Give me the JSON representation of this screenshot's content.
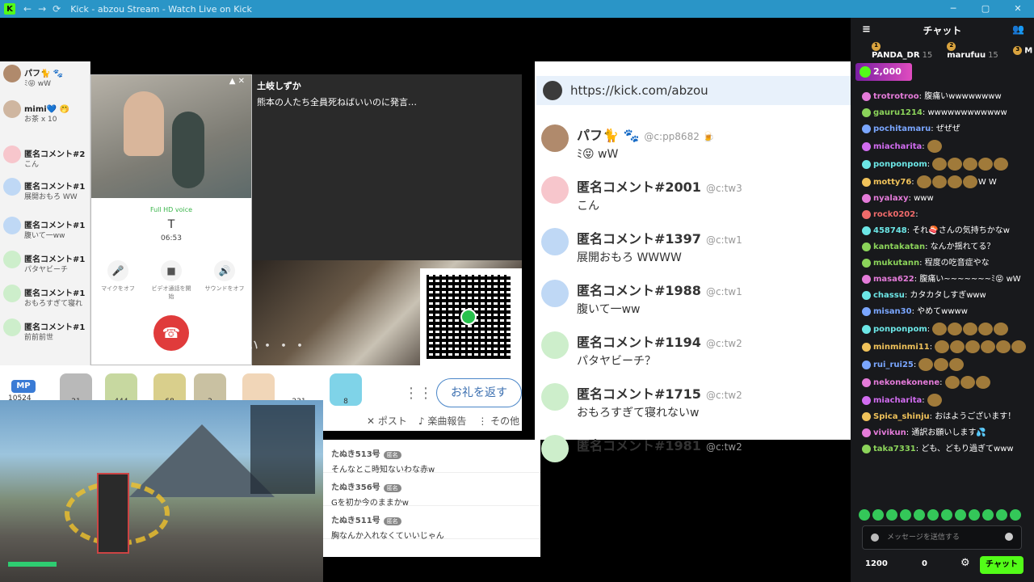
{
  "window": {
    "title": "Kick - abzou Stream - Watch Live on Kick",
    "logo": "K",
    "back": "←",
    "forward": "→",
    "reload": "⟳",
    "minimize": "─",
    "maximize": "▢",
    "close": "✕"
  },
  "left_chat": [
    {
      "name": "パフ🐈 🐾",
      "text": "ﾐ😝 wW",
      "avatar_color": "#b08a6c"
    },
    {
      "name": "mimi💙 🤭",
      "text": "お茶 x 10",
      "avatar_color": "#cfb6a0"
    },
    {
      "name": "匿名コメント#2",
      "text": "こん",
      "avatar_color": "#f7c6cc"
    },
    {
      "name": "匿名コメント#1",
      "text": "展開おもろ WW",
      "avatar_color": "#bfd8f5"
    },
    {
      "name": "匿名コメント#1",
      "text": "腹いて一ww",
      "avatar_color": "#bfd8f5"
    },
    {
      "name": "匿名コメント#1",
      "text": "パタヤビーチ",
      "avatar_color": "#cdeecb"
    },
    {
      "name": "匿名コメント#1",
      "text": "おもろすぎて寝れ",
      "avatar_color": "#cdeecb"
    },
    {
      "name": "匿名コメント#1",
      "text": "前前前世",
      "avatar_color": "#cdeecb"
    }
  ],
  "phone": {
    "quality": "Full HD voice",
    "contact": "T",
    "duration": "06:53",
    "mute_label": "マイクをオフ",
    "video_label": "ビデオ通話を開始",
    "sound_label": "サウンドをオフ",
    "mic_icon": "🎤",
    "video_icon": "■",
    "sound_icon": "🔊",
    "hangup_icon": "☎",
    "window_controls": "▲ ✕"
  },
  "dark_panel": {
    "name": "土岐しずか",
    "message": "熊本の人たち全員死ねばいいのに発言…"
  },
  "overlay_text": "やばい・・・",
  "giftbar": {
    "mp_label": "MP",
    "mp_value": "10524",
    "thanks_button": "お礼を返す",
    "gifts": [
      {
        "label": "21",
        "color": "#b9b9b9"
      },
      {
        "label": "444",
        "color": "#c7d8a0"
      },
      {
        "label": "68",
        "color": "#d9cf8c"
      },
      {
        "label": "2",
        "color": "#c9c1a2"
      },
      {
        "label": "",
        "color": "#f1d6b8"
      },
      {
        "label": "231",
        "color": "#ffffff"
      },
      {
        "label": "8",
        "color": "#7fd3e8"
      }
    ]
  },
  "sharebar": {
    "post": "✕ ポスト",
    "song": "♪ 楽曲報告",
    "more": "⋮ その他"
  },
  "right_panel": {
    "url": "https://kick.com/abzou",
    "comments": [
      {
        "name": "パフ🐈 🐾",
        "tag": "@c:pp8682 🍺",
        "text": "ﾐ😝 wW",
        "avatar_color": "#b08a6c"
      },
      {
        "name": "匿名コメント#2001",
        "tag": "@c:tw3",
        "text": "こん",
        "avatar_color": "#f7c6cc"
      },
      {
        "name": "匿名コメント#1397",
        "tag": "@c:tw1",
        "text": "展開おもろ WWWW",
        "avatar_color": "#bfd8f5"
      },
      {
        "name": "匿名コメント#1988",
        "tag": "@c:tw1",
        "text": "腹いて一ww",
        "avatar_color": "#bfd8f5"
      },
      {
        "name": "匿名コメント#1194",
        "tag": "@c:tw2",
        "text": "パタヤビーチ？",
        "avatar_color": "#cdeecb"
      },
      {
        "name": "匿名コメント#1715",
        "tag": "@c:tw2",
        "text": "おもろすぎて寝れないw",
        "avatar_color": "#cdeecb"
      },
      {
        "name": "匿名コメント#1981",
        "tag": "@c:tw2",
        "text": "",
        "avatar_color": "#cdeecb"
      }
    ]
  },
  "lower_comments": [
    {
      "name": "たぬき513号",
      "badge": "匿名",
      "text": "そんなとこ時知ないわな赤w"
    },
    {
      "name": "たぬき356号",
      "badge": "匿名",
      "text": "Gを初か今のままかw"
    },
    {
      "name": "たぬき511号",
      "badge": "匿名",
      "text": "胸なんか入れなくていいじゃん"
    }
  ],
  "chat": {
    "header": "チャット",
    "collapse_icon": "≡",
    "users_icon": "👥",
    "leaderboard": [
      {
        "rank": "1",
        "name": "PANDA_DR",
        "points": "15"
      },
      {
        "rank": "2",
        "name": "marufuu",
        "points": "15"
      },
      {
        "rank": "3",
        "name": "M",
        "points": ""
      }
    ],
    "pinned_amount": "2,000",
    "messages": [
      {
        "user": "trotrotroo",
        "color": "#e47bd9",
        "text": "腹痛いwwwwwwww"
      },
      {
        "user": "gauru1214",
        "color": "#8bd35a",
        "text": "wwwwwwwwwwww"
      },
      {
        "user": "pochitamaru",
        "color": "#7aa6ff",
        "text": "ぜぜぜ"
      },
      {
        "user": "miacharita",
        "color": "#d16cf0",
        "text": ""
      },
      {
        "user": "ponponpom",
        "color": "#6ce6e6",
        "text": ""
      },
      {
        "user": "motty76",
        "color": "#f0c25a",
        "text": "W W"
      },
      {
        "user": "nyalaxy",
        "color": "#e47bd9",
        "text": "www"
      },
      {
        "user": "rock0202",
        "color": "#f06b6b",
        "text": ""
      },
      {
        "user": "458748",
        "color": "#6ce6e6",
        "text": "それ🍣さんの気持ちかなw"
      },
      {
        "user": "kantakatan",
        "color": "#8bd35a",
        "text": "なんか揺れてる？"
      },
      {
        "user": "mukutann",
        "color": "#8bd35a",
        "text": "程度の吃音症やな"
      },
      {
        "user": "masa622",
        "color": "#e47bd9",
        "text": "腹痛い~~~~~~~ﾐ😝 wW"
      },
      {
        "user": "chassu",
        "color": "#6ce6e6",
        "text": "カタカタしすぎwww"
      },
      {
        "user": "misan30",
        "color": "#7aa6ff",
        "text": "やめてwwww"
      },
      {
        "user": "ponponpom",
        "color": "#6ce6e6",
        "text": ""
      },
      {
        "user": "minminmi11",
        "color": "#f0c25a",
        "text": ""
      },
      {
        "user": "rui_rui25",
        "color": "#7aa6ff",
        "text": ""
      },
      {
        "user": "nekonekonene",
        "color": "#e47bd9",
        "text": ""
      },
      {
        "user": "miacharita",
        "color": "#d16cf0",
        "text": ""
      },
      {
        "user": "Spica_shinju",
        "color": "#f0c25a",
        "text": "おはようございます！"
      },
      {
        "user": "vivikun",
        "color": "#e47bd9",
        "text": "通訳お願いします💦"
      },
      {
        "user": "taka7331",
        "color": "#8bd35a",
        "text": "ども、どもり過ぎてwww"
      }
    ],
    "input_placeholder": "メッセージを送信する",
    "points": "1200",
    "zero": "0",
    "send_button": "チャット"
  }
}
